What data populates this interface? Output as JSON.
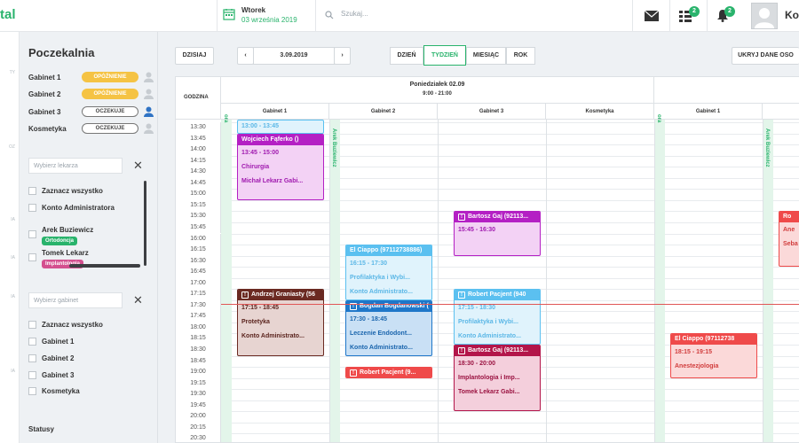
{
  "topbar": {
    "logo": "tal",
    "day_name": "Wtorek",
    "date_text": "03 września 2019",
    "search_placeholder": "Szukaj...",
    "tasks_badge": "2",
    "notifications_badge": "2",
    "user_name": "Ko"
  },
  "rail": {
    "labels": [
      "TY",
      "OZ",
      "IA",
      "IA",
      "IA",
      "IA"
    ]
  },
  "waiting_room": {
    "title": "Poczekalnia",
    "rooms": [
      {
        "label": "Gabinet 1",
        "status": "OPÓŹNIENIE",
        "kind": "late"
      },
      {
        "label": "Gabinet 2",
        "status": "OPÓŹNIENIE",
        "kind": "late"
      },
      {
        "label": "Gabinet 3",
        "status": "OCZEKUJE",
        "kind": "wait"
      },
      {
        "label": "Kosmetyka",
        "status": "OCZEKUJE",
        "kind": "wait"
      }
    ],
    "doctor_filter_placeholder": "Wybierz lekarza",
    "doctor_options": [
      {
        "label": "Zaznacz wszystko"
      },
      {
        "label": "Konto Administratora"
      },
      {
        "label": "Arek Buziewicz",
        "tag": "Ortodoncja",
        "tag_color": "#29b36c"
      },
      {
        "label": "Tomek Lekarz",
        "tag": "Implantologia",
        "tag_color": "#d4508f"
      }
    ],
    "room_filter_placeholder": "Wybierz gabinet",
    "room_options": [
      "Zaznacz wszystko",
      "Gabinet 1",
      "Gabinet 2",
      "Gabinet 3",
      "Kosmetyka"
    ],
    "statuses_title": "Statusy"
  },
  "toolbar": {
    "today": "DZISIAJ",
    "current_date": "3.09.2019",
    "prev": "‹",
    "next": "›",
    "views": [
      "DZIEŃ",
      "TYDZIEŃ",
      "MIESIĄC",
      "ROK"
    ],
    "active_view": "TYDZIEŃ",
    "hide_button": "UKRYJ DANE OSO"
  },
  "calendar": {
    "hours_header": "GODZINA",
    "day_title": "Poniedziałek 02.09",
    "day_hours": "9:00 - 21:00",
    "rooms": [
      "Gabinet 1",
      "Gabinet 2",
      "Gabinet 3",
      "Kosmetyka"
    ],
    "next_day_room": "Gabinet 1",
    "doctor_label": "Arek Buziewicz",
    "times": [
      "13:30",
      "13:45",
      "14:00",
      "14:15",
      "14:30",
      "14:45",
      "15:00",
      "15:15",
      "15:30",
      "15:45",
      "16:00",
      "16:15",
      "16:30",
      "16:45",
      "17:00",
      "17:15",
      "17:30",
      "17:45",
      "18:00",
      "18:15",
      "18:30",
      "18:45",
      "19:00",
      "19:15",
      "19:30",
      "19:45",
      "20:00",
      "20:15",
      "20:30"
    ],
    "appointments": [
      {
        "col": 0,
        "start": "13:00",
        "end": "13:45",
        "header": "",
        "time": "13:00 - 13:45",
        "lines": [],
        "color": "#5bc0f0",
        "bg": "#e0f3fc",
        "text": "#5bb7e6"
      },
      {
        "col": 0,
        "start": "13:45",
        "end": "15:15",
        "header": "Wojciech Fąferko ()",
        "time": "13:45 - 15:00",
        "lines": [
          "Chirurgia",
          "Michał Lekarz Gabi..."
        ],
        "color": "#b420c4",
        "bg": "#f3d2f5",
        "text": "#a01aaf"
      },
      {
        "col": 1,
        "start": "16:15",
        "end": "17:30",
        "header": "El Ciappo (97112738886)",
        "time": "16:15 - 17:30",
        "lines": [
          "Profilaktyka i Wybi...",
          "Konto Administrato..."
        ],
        "color": "#5bc0f0",
        "bg": "#e0f3fc",
        "text": "#5bb7e6",
        "icon": false
      },
      {
        "col": 1,
        "start": "17:30",
        "end": "18:45",
        "header": "Bogdan Bogdanowski (",
        "time": "17:30 - 18:45",
        "lines": [
          "Leczenie Endodont...",
          "Konto Administrato..."
        ],
        "color": "#1f77c9",
        "bg": "#c9e0f5",
        "text": "#1a65ad",
        "icon": true
      },
      {
        "col": 1,
        "start": "19:00",
        "end": "19:15",
        "header": "Robert Pacjent (9...",
        "time": "",
        "lines": [],
        "color": "#ef4a4a",
        "bg": "#fbd9d9",
        "text": "#d13c3c",
        "icon": true
      },
      {
        "col": 0,
        "start": "17:15",
        "end": "18:45",
        "header": "Andrzej Graniasty (56",
        "time": "17:15 - 18:45",
        "lines": [
          "Protetyka",
          "Konto Administrato..."
        ],
        "color": "#6b2a22",
        "bg": "#e7d4d1",
        "text": "#5a231d",
        "icon": true
      },
      {
        "col": 2,
        "start": "15:30",
        "end": "16:30",
        "header": "Bartosz Gaj (92113...",
        "time": "15:45 - 16:30",
        "lines": [],
        "color": "#b420c4",
        "bg": "#f3d2f5",
        "text": "#a01aaf",
        "icon": true
      },
      {
        "col": 2,
        "start": "17:15",
        "end": "18:30",
        "header": "Robert Pacjent (940",
        "time": "17:15 - 18:30",
        "lines": [
          "Profilaktyka i Wybi...",
          "Konto Administrato..."
        ],
        "color": "#5bc0f0",
        "bg": "#e0f3fc",
        "text": "#5bb7e6",
        "icon": true
      },
      {
        "col": 2,
        "start": "18:30",
        "end": "20:00",
        "header": "Bartosz Gaj (92113...",
        "time": "18:30 - 20:00",
        "lines": [
          "Implantologia i Imp...",
          "Tomek Lekarz Gabi..."
        ],
        "color": "#b3154a",
        "bg": "#f4cfdc",
        "text": "#9a1240",
        "icon": true
      },
      {
        "col": 4,
        "start": "18:15",
        "end": "19:15",
        "header": "El Ciappo (97112738",
        "time": "18:15 - 19:15",
        "lines": [
          "Anestezjologia"
        ],
        "color": "#ef4a4a",
        "bg": "#fbd9d9",
        "text": "#d13c3c",
        "icon": false
      },
      {
        "col": 5,
        "start": "15:30",
        "end": "16:45",
        "header": "Ro",
        "time": "",
        "lines": [
          "Ane",
          "Seba"
        ],
        "color": "#ef4a4a",
        "bg": "#fbd9d9",
        "text": "#d13c3c",
        "icon": false
      }
    ],
    "now_time": "17:35"
  },
  "colors": {
    "accent": "#29b36c",
    "late": "#f5c344",
    "now_line": "#e05656"
  }
}
